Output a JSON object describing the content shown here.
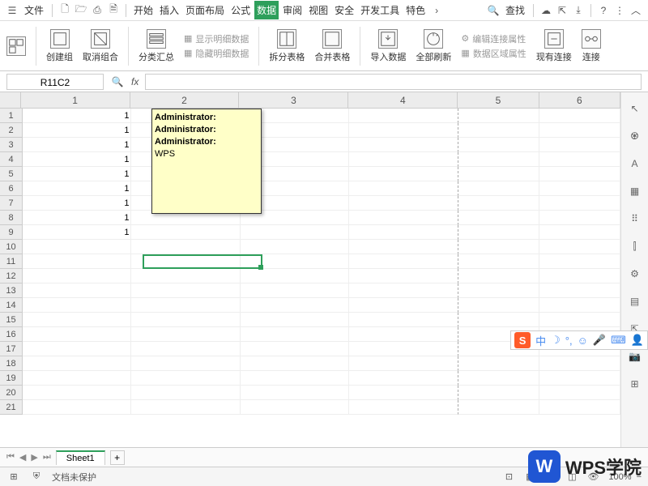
{
  "menu": {
    "file": "文件",
    "tabs": [
      "开始",
      "插入",
      "页面布局",
      "公式",
      "数据",
      "审阅",
      "视图",
      "安全",
      "开发工具",
      "特色"
    ],
    "active_tab": 4,
    "search": "查找"
  },
  "ribbon": {
    "pivot_label": "",
    "create_group": "创建组",
    "ungroup": "取消组合",
    "subtotal": "分类汇总",
    "show_detail": "显示明细数据",
    "hide_detail": "隐藏明细数据",
    "split_table": "拆分表格",
    "merge_table": "合并表格",
    "import_data": "导入数据",
    "refresh_all": "全部刷新",
    "edit_conn": "编辑连接属性",
    "data_range": "数据区域属性",
    "existing_conn": "现有连接",
    "connections": "连接"
  },
  "formula_bar": {
    "name_box": "R11C2",
    "fx": "fx"
  },
  "columns": [
    "1",
    "2",
    "3",
    "4",
    "5",
    "6"
  ],
  "rows": [
    "1",
    "2",
    "3",
    "4",
    "5",
    "6",
    "7",
    "8",
    "9",
    "10",
    "11",
    "12",
    "13",
    "14",
    "15",
    "16",
    "17",
    "18",
    "19",
    "20",
    "21"
  ],
  "col1_values": [
    "1",
    "1",
    "1",
    "1",
    "1",
    "1",
    "1",
    "1",
    "1"
  ],
  "comment": {
    "lines": [
      "Administrator:",
      "Administrator:",
      "Administrator:",
      "WPS"
    ]
  },
  "active": {
    "row": 11,
    "col": 2
  },
  "sheet_tabs": {
    "active": "Sheet1"
  },
  "status": {
    "protect": "文档未保护",
    "zoom": "100%"
  },
  "logo": {
    "brand": "W",
    "text": "WPS学院"
  },
  "ime": {
    "logo": "S",
    "lang": "中"
  }
}
